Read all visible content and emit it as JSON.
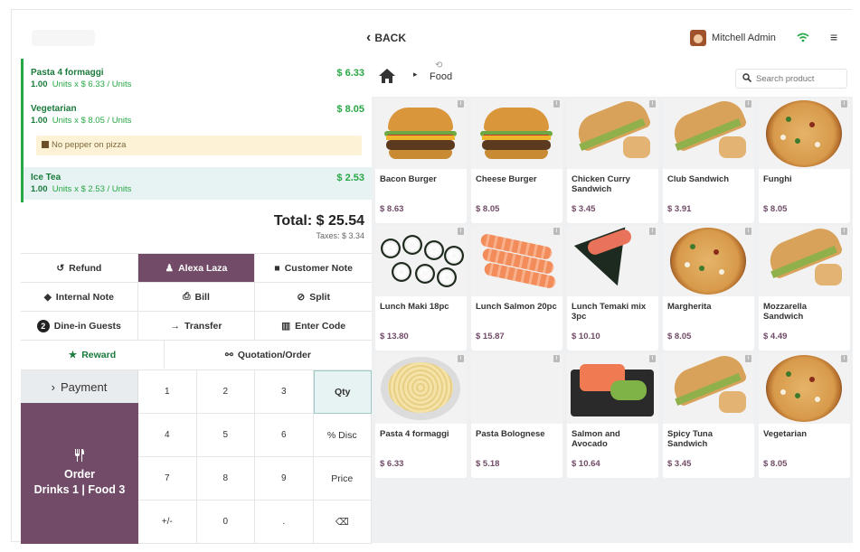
{
  "topbar": {
    "back_label": "BACK",
    "user_name": "Mitchell Admin"
  },
  "order": {
    "lines": [
      {
        "name": "Pasta 4 formaggi",
        "qty": "1.00",
        "unit_text": "Units x $ 6.33 / Units",
        "price": "$ 6.33"
      },
      {
        "name": "Vegetarian",
        "qty": "1.00",
        "unit_text": "Units x $ 8.05 / Units",
        "price": "$ 8.05",
        "note": "No pepper on pizza"
      },
      {
        "name": "Ice Tea",
        "qty": "1.00",
        "unit_text": "Units x $ 2.53 / Units",
        "price": "$ 2.53"
      }
    ],
    "total": "Total: $ 25.54",
    "taxes": "Taxes: $ 3.34"
  },
  "actions": {
    "refund": "Refund",
    "customer": "Alexa Laza",
    "customer_note": "Customer Note",
    "internal_note": "Internal Note",
    "bill": "Bill",
    "split": "Split",
    "guests_count": "2",
    "guests": "Dine-in Guests",
    "transfer": "Transfer",
    "enter_code": "Enter Code",
    "reward": "Reward",
    "quotation": "Quotation/Order"
  },
  "keypad": {
    "payment": "Payment",
    "order_line1": "Order",
    "order_line2": "Drinks 1 | Food 3",
    "keys": [
      "1",
      "2",
      "3",
      "Qty",
      "4",
      "5",
      "6",
      "% Disc",
      "7",
      "8",
      "9",
      "Price",
      "+/-",
      "0",
      ".",
      "⌫"
    ]
  },
  "catalog": {
    "category": "Food",
    "search_placeholder": "Search product",
    "products": [
      {
        "name": "Bacon Burger",
        "price": "$ 8.63",
        "img": "burger"
      },
      {
        "name": "Cheese Burger",
        "price": "$ 8.05",
        "img": "burger"
      },
      {
        "name": "Chicken Curry Sandwich",
        "price": "$ 3.45",
        "img": "sandwich"
      },
      {
        "name": "Club Sandwich",
        "price": "$ 3.91",
        "img": "sandwich"
      },
      {
        "name": "Funghi",
        "price": "$ 8.05",
        "img": "pizza"
      },
      {
        "name": "Lunch Maki 18pc",
        "price": "$ 13.80",
        "img": "sushi"
      },
      {
        "name": "Lunch Salmon 20pc",
        "price": "$ 15.87",
        "img": "salmon"
      },
      {
        "name": "Lunch Temaki mix 3pc",
        "price": "$ 10.10",
        "img": "temaki"
      },
      {
        "name": "Margherita",
        "price": "$ 8.05",
        "img": "pizza"
      },
      {
        "name": "Mozzarella Sandwich",
        "price": "$ 4.49",
        "img": "sandwich"
      },
      {
        "name": "Pasta 4 formaggi",
        "price": "$ 6.33",
        "img": "pasta"
      },
      {
        "name": "Pasta Bolognese",
        "price": "$ 5.18",
        "img": "bolo"
      },
      {
        "name": "Salmon and Avocado",
        "price": "$ 10.64",
        "img": "avocado"
      },
      {
        "name": "Spicy Tuna Sandwich",
        "price": "$ 3.45",
        "img": "sandwich"
      },
      {
        "name": "Vegetarian",
        "price": "$ 8.05",
        "img": "pizza"
      }
    ]
  },
  "colors": {
    "brand_purple": "#714b67",
    "accent_green": "#28a745"
  }
}
